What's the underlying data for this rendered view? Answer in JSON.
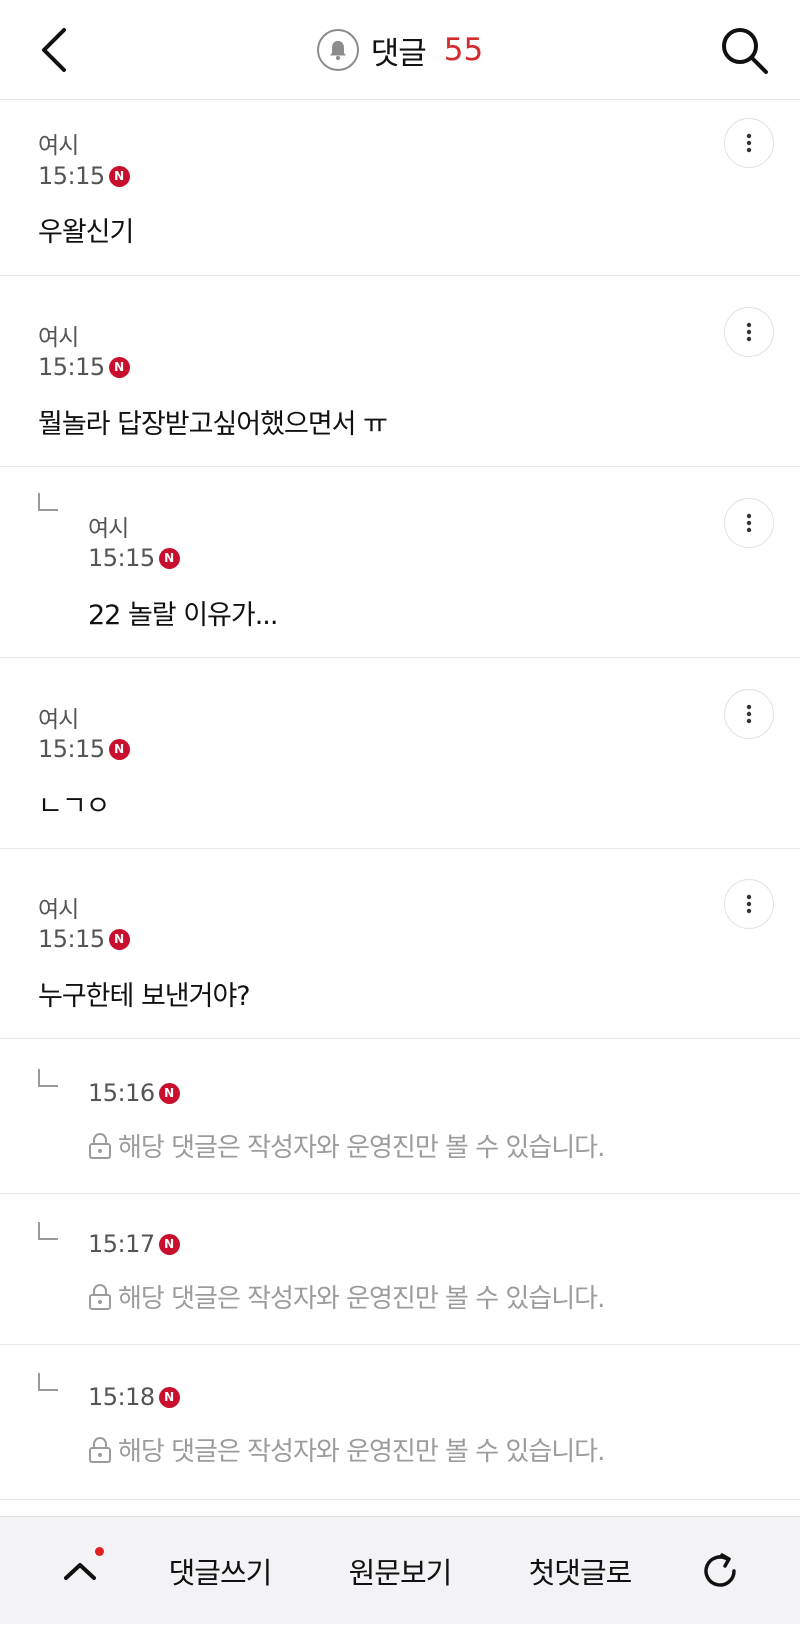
{
  "header": {
    "title": "댓글",
    "count": "55",
    "back_icon": "chevron-left-icon",
    "bell_icon": "bell-icon",
    "search_icon": "search-icon"
  },
  "comments": [
    {
      "author": "여시",
      "time": "15:15",
      "badge": "N",
      "text": "우왈신기"
    },
    {
      "author": "여시",
      "time": "15:15",
      "badge": "N",
      "text": "뭘놀라 답장받고싶어했으면서 ㅠ"
    },
    {
      "author": "여시",
      "time": "15:15",
      "badge": "N",
      "text": "22 놀랄 이유가..."
    },
    {
      "author": "여시",
      "time": "15:15",
      "badge": "N",
      "text": "ㄴㄱㅇ"
    },
    {
      "author": "여시",
      "time": "15:15",
      "badge": "N",
      "text": "누구한테 보낸거야?"
    },
    {
      "time": "15:16",
      "badge": "N",
      "text": "해당 댓글은 작성자와 운영진만 볼 수 있습니다."
    },
    {
      "time": "15:17",
      "badge": "N",
      "text": "해당 댓글은 작성자와 운영진만 볼 수 있습니다."
    },
    {
      "time": "15:18",
      "badge": "N",
      "text": "해당 댓글은 작성자와 운영진만 볼 수 있습니다."
    }
  ],
  "bottom_bar": {
    "write_label": "댓글쓰기",
    "original_label": "원문보기",
    "first_label": "첫댓글로",
    "up_icon": "chevron-up-icon",
    "refresh_icon": "refresh-icon"
  },
  "colors": {
    "accent_red": "#d42c2c",
    "badge_red": "#c8102e",
    "muted": "#9c9c9c"
  }
}
